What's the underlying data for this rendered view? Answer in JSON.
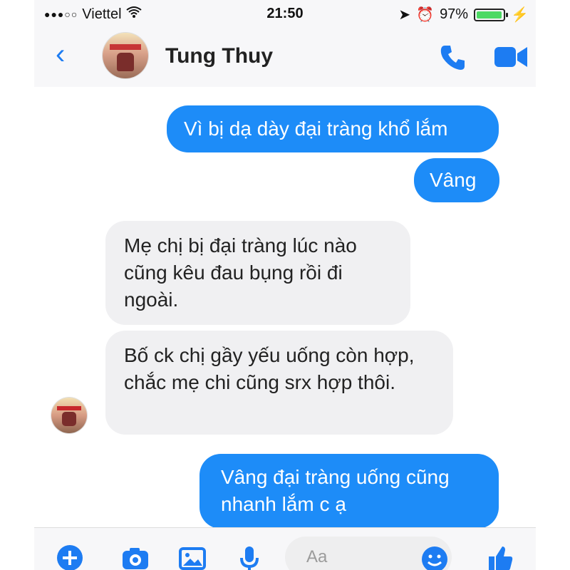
{
  "status": {
    "carrier": "Viettel",
    "time": "21:50",
    "battery": "97%",
    "battery_level": 0.97
  },
  "header": {
    "name": "Tung Thuy",
    "back_icon": "chevron-left-icon",
    "phone_icon": "phone-icon",
    "video_icon": "video-icon"
  },
  "messages": [
    {
      "sender": "me",
      "text": "Vì bị dạ dày đại tràng khổ lắm"
    },
    {
      "sender": "me",
      "text": "Vâng"
    },
    {
      "sender": "them",
      "text": "Mẹ chị bị đại tràng lúc nào cũng kêu đau bụng rồi đi ngoài."
    },
    {
      "sender": "them",
      "text": "Bố ck chị gầy yếu uống còn hợp, chắc mẹ chi cũng srx hợp thôi."
    },
    {
      "sender": "me",
      "text": "Vâng đại tràng uống cũng nhanh lắm c ạ"
    }
  ],
  "composer": {
    "placeholder": "Aa"
  },
  "colors": {
    "accent": "#1d8cf8",
    "incoming_bubble": "#f0f0f2",
    "header_bg": "#f7f7f9"
  }
}
